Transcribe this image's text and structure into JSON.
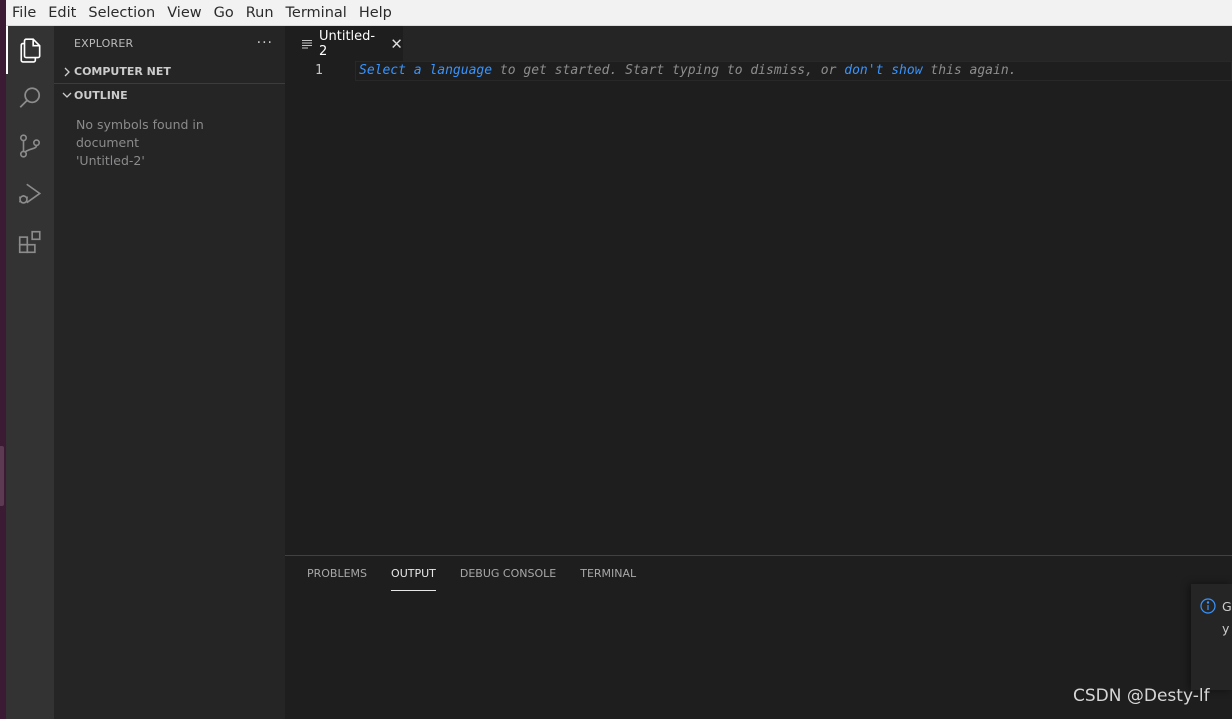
{
  "menubar": {
    "items": [
      "File",
      "Edit",
      "Selection",
      "View",
      "Go",
      "Run",
      "Terminal",
      "Help"
    ]
  },
  "activitybar": {
    "icons": [
      "files-icon",
      "search-icon",
      "source-control-icon",
      "run-debug-icon",
      "extensions-icon"
    ]
  },
  "sidebar": {
    "title": "EXPLORER",
    "more": "···",
    "sections": [
      {
        "label": "COMPUTER NET",
        "expanded": false
      },
      {
        "label": "OUTLINE",
        "expanded": true
      }
    ],
    "outline_message_line1": "No symbols found in document",
    "outline_message_line2": "'Untitled-2'"
  },
  "editor": {
    "tab_label": "Untitled-2",
    "line_number": "1",
    "hint": {
      "select_language": "Select a language",
      "part2": " to get started. Start typing to dismiss, or ",
      "dont_show": "don't show",
      "part3": " this again."
    }
  },
  "panel": {
    "tabs": [
      "PROBLEMS",
      "OUTPUT",
      "DEBUG CONSOLE",
      "TERMINAL"
    ],
    "active_tab": "OUTPUT"
  },
  "notification": {
    "text_line1": "G",
    "text_line2": "y"
  },
  "watermark": "CSDN @Desty-lf",
  "colors": {
    "accent_link": "#3794ff",
    "activitybar": "#333333",
    "sidebar": "#252526",
    "editor": "#1e1e1e"
  }
}
